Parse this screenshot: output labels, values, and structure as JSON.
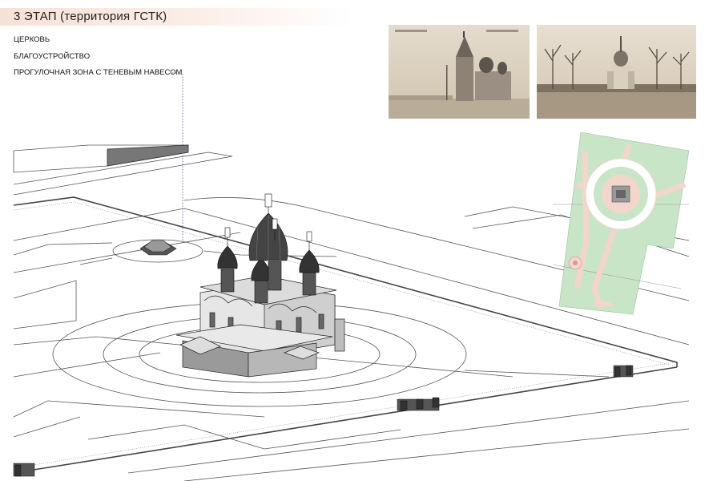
{
  "header": {
    "title": "3 ЭТАП (территория ГСТК)"
  },
  "legend": {
    "items": [
      {
        "label": "ЦЕРКОВЬ"
      },
      {
        "label": "БЛАГОУСТРОЙСТВО"
      },
      {
        "label": "ПРОГУЛОЧНАЯ ЗОНА С ТЕНЕВЫМ НАВЕСОМ"
      }
    ]
  },
  "colors": {
    "title_band": "#f7e1d6",
    "sepia_photo": "#c9bca6",
    "plan_green": "#c9e5c7",
    "plan_path": "#f2d6cc",
    "line": "#444444",
    "leader": "#5a7fb5"
  }
}
